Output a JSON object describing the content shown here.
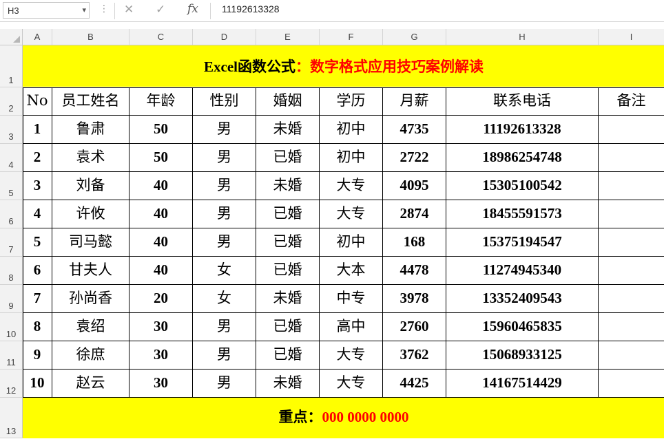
{
  "formula_bar": {
    "name_box": "H3",
    "cancel_symbol": "✕",
    "enter_symbol": "✓",
    "fx_label": "fx",
    "formula_value": "11192613328"
  },
  "column_headers": [
    "A",
    "B",
    "C",
    "D",
    "E",
    "F",
    "G",
    "H",
    "I"
  ],
  "row_headers": [
    "1",
    "2",
    "3",
    "4",
    "5",
    "6",
    "7",
    "8",
    "9",
    "10",
    "11",
    "12",
    "13"
  ],
  "title": {
    "part1": "Excel函数公式",
    "part2": "：数字格式应用技巧案例解读"
  },
  "table": {
    "headers": [
      "No",
      "员工姓名",
      "年龄",
      "性别",
      "婚姻",
      "学历",
      "月薪",
      "联系电话",
      "备注"
    ],
    "rows": [
      [
        "1",
        "鲁肃",
        "50",
        "男",
        "未婚",
        "初中",
        "4735",
        "11192613328",
        ""
      ],
      [
        "2",
        "袁术",
        "50",
        "男",
        "已婚",
        "初中",
        "2722",
        "18986254748",
        ""
      ],
      [
        "3",
        "刘备",
        "40",
        "男",
        "未婚",
        "大专",
        "4095",
        "15305100542",
        ""
      ],
      [
        "4",
        "许攸",
        "40",
        "男",
        "已婚",
        "大专",
        "2874",
        "18455591573",
        ""
      ],
      [
        "5",
        "司马懿",
        "40",
        "男",
        "已婚",
        "初中",
        "168",
        "15375194547",
        ""
      ],
      [
        "6",
        "甘夫人",
        "40",
        "女",
        "已婚",
        "大本",
        "4478",
        "11274945340",
        ""
      ],
      [
        "7",
        "孙尚香",
        "20",
        "女",
        "未婚",
        "中专",
        "3978",
        "13352409543",
        ""
      ],
      [
        "8",
        "袁绍",
        "30",
        "男",
        "已婚",
        "高中",
        "2760",
        "15960465835",
        ""
      ],
      [
        "9",
        "徐庶",
        "30",
        "男",
        "已婚",
        "大专",
        "3762",
        "15068933125",
        ""
      ],
      [
        "10",
        "赵云",
        "30",
        "男",
        "未婚",
        "大专",
        "4425",
        "14167514429",
        ""
      ]
    ]
  },
  "footer": {
    "part1": "重点：",
    "part2": "000  0000  0000"
  },
  "colors": {
    "banner_bg": "#ffff00",
    "accent_red": "#ff0000"
  }
}
